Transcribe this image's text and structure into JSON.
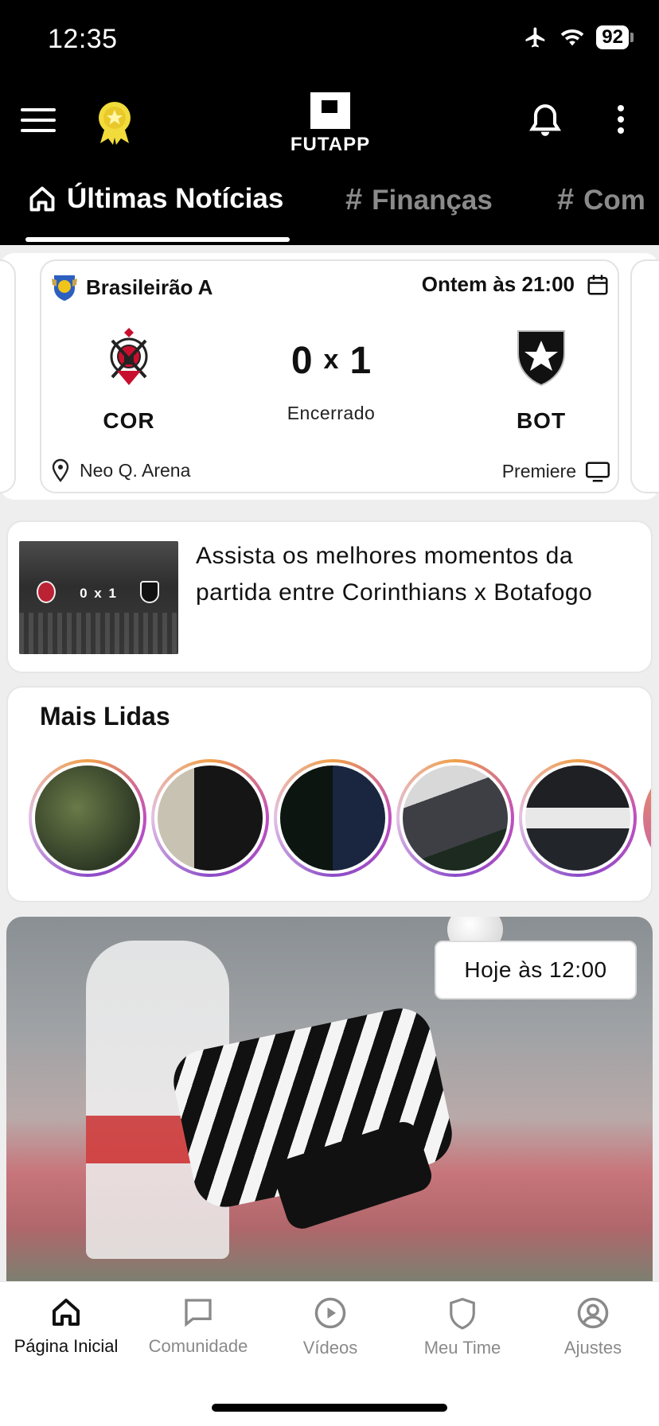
{
  "status_bar": {
    "time": "12:35",
    "battery": "92"
  },
  "header": {
    "logo_text": "FUTAPP"
  },
  "tabs": [
    {
      "label": "Últimas Notícias",
      "active": true
    },
    {
      "label": "Finanças",
      "active": false
    },
    {
      "label": "Com",
      "active": false
    }
  ],
  "match": {
    "league": "Brasileirão A",
    "datetime": "Ontem às 21:00",
    "home_code": "COR",
    "away_code": "BOT",
    "home_score": "0",
    "away_score": "1",
    "separator": "x",
    "status": "Encerrado",
    "venue": "Neo Q. Arena",
    "broadcast": "Premiere"
  },
  "highlight": {
    "title": "Assista os melhores momentos da partida entre Corinthians x Botafogo",
    "thumb_score": "0 x 1"
  },
  "most_read": {
    "title": "Mais Lidas",
    "count": 5
  },
  "article": {
    "time": "Hoje às 12:00"
  },
  "bottom_nav": [
    {
      "label": "Página Inicial",
      "icon": "home-icon",
      "active": true
    },
    {
      "label": "Comunidade",
      "icon": "chat-bubble-icon",
      "active": false
    },
    {
      "label": "Vídeos",
      "icon": "play-circle-icon",
      "active": false
    },
    {
      "label": "Meu Time",
      "icon": "shield-icon",
      "active": false
    },
    {
      "label": "Ajustes",
      "icon": "user-circle-icon",
      "active": false
    }
  ],
  "colors": {
    "header_bg": "#000000",
    "active": "#111111",
    "inactive": "#8a8a8a",
    "story_ring": "#c04ec0"
  }
}
